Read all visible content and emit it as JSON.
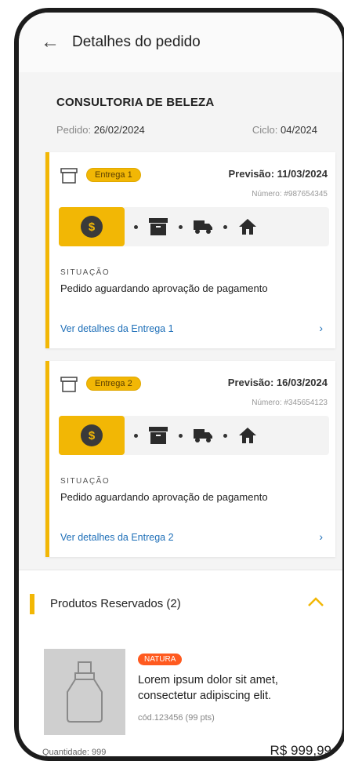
{
  "header": {
    "title": "Detalhes do pedido"
  },
  "order": {
    "company": "CONSULTORIA DE BELEZA",
    "pedido_label": "Pedido:",
    "pedido_value": "26/02/2024",
    "ciclo_label": "Ciclo:",
    "ciclo_value": "04/2024"
  },
  "deliveries": [
    {
      "badge": "Entrega 1",
      "previsao": "Previsão: 11/03/2024",
      "numero": "Número: #987654345",
      "situacao_label": "SITUAÇÃO",
      "situacao": "Pedido aguardando aprovação de pagamento",
      "link": "Ver detalhes da Entrega 1"
    },
    {
      "badge": "Entrega 2",
      "previsao": "Previsão: 16/03/2024",
      "numero": "Número: #345654123",
      "situacao_label": "SITUAÇÃO",
      "situacao": "Pedido aguardando aprovação de pagamento",
      "link": "Ver detalhes da Entrega 2"
    }
  ],
  "reserved": {
    "title": "Produtos Reservados (2)",
    "product": {
      "brand": "NATURA",
      "description": "Lorem ipsum dolor sit amet, consectetur adipiscing elit.",
      "code": "cód.123456  (99 pts)",
      "quantity": "Quantidade: 999",
      "price": "R$ 999,99"
    }
  },
  "colors": {
    "accent": "#f2b705",
    "link": "#1e6fb8",
    "brand_badge": "#ff5a1f"
  },
  "icons": [
    "back-arrow-icon",
    "box-icon",
    "dollar-icon",
    "package-icon",
    "truck-icon",
    "home-icon",
    "chevron-right-icon",
    "chevron-up-icon",
    "bottle-icon"
  ]
}
